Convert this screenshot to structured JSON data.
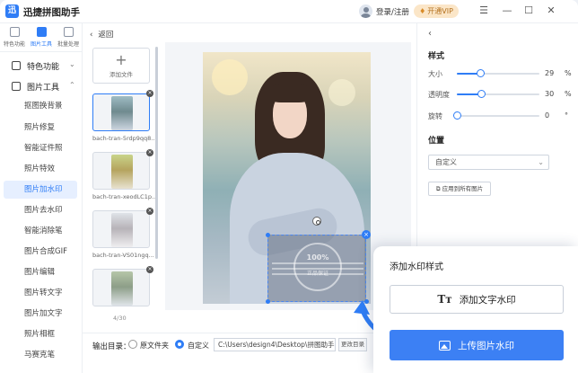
{
  "app": {
    "title": "迅捷拼图助手",
    "logo_char": "迅"
  },
  "header": {
    "login_label": "登录/注册",
    "vip_label": "开通VIP",
    "menu_glyph": "☰",
    "minimize_glyph": "—",
    "maximize_glyph": "☐",
    "close_glyph": "✕"
  },
  "topnav": [
    {
      "label": "特色功能"
    },
    {
      "label": "图片工具"
    },
    {
      "label": "批量处理"
    }
  ],
  "sidebar": {
    "group_featured": "特色功能",
    "group_image_tools": "图片工具",
    "items": [
      {
        "label": "抠图换背景"
      },
      {
        "label": "照片修复"
      },
      {
        "label": "智能证件照"
      },
      {
        "label": "照片特效"
      },
      {
        "label": "图片加水印"
      },
      {
        "label": "图片去水印"
      },
      {
        "label": "智能消除笔"
      },
      {
        "label": "图片合成GIF"
      },
      {
        "label": "图片编辑"
      },
      {
        "label": "图片转文字"
      },
      {
        "label": "图片加文字"
      },
      {
        "label": "照片相框"
      },
      {
        "label": "马赛克笔"
      }
    ]
  },
  "middle": {
    "back_label": "返回",
    "add_file_label": "添加文件",
    "thumbnails": [
      {
        "name": "bach-tran-5rdp9qq8..."
      },
      {
        "name": "bach-tran-xeodLC1p..."
      },
      {
        "name": "bach-tran-VS01ngq..."
      }
    ],
    "page_count": "4/30"
  },
  "output": {
    "label": "输出目录：",
    "option_source": "原文件夹",
    "option_custom": "自定义",
    "path": "C:\\Users\\design4\\Desktop\\拼图助手",
    "change_dir_label": "更改目录"
  },
  "style_panel": {
    "section_style": "样式",
    "size_label": "大小",
    "size_value": "29",
    "size_unit": "%",
    "size_fraction": 0.29,
    "opacity_label": "透明度",
    "opacity_value": "30",
    "opacity_unit": "%",
    "opacity_fraction": 0.3,
    "rotate_label": "旋转",
    "rotate_value": "0",
    "rotate_unit": "°",
    "rotate_fraction": 0,
    "section_position": "位置",
    "position_value": "自定义",
    "apply_all_label": "应用到所有图片"
  },
  "watermark": {
    "seal_top": "100%",
    "seal_bottom": "正品保证"
  },
  "popup": {
    "title": "添加水印样式",
    "text_btn_label": "添加文字水印",
    "image_btn_label": "上传图片水印"
  },
  "colors": {
    "accent": "#2f7df6",
    "vip_bg": "#fbe6c8",
    "vip_text": "#b4711e"
  }
}
